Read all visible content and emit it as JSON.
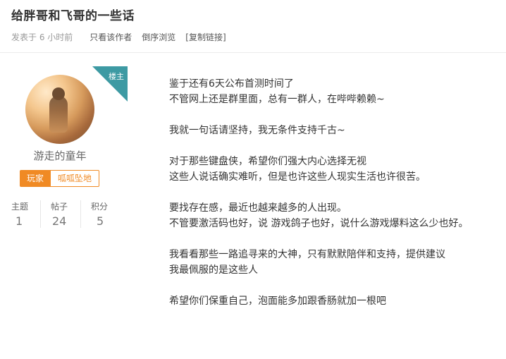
{
  "header": {
    "title": "给胖哥和飞哥的一些话"
  },
  "meta": {
    "posted": "发表于  6 小时前",
    "author_only": "只看该作者",
    "reverse_order": "倒序浏览",
    "copy_link": "[复制链接]"
  },
  "author": {
    "owner_badge": "楼主",
    "name": "游走的童年",
    "tags": [
      "玩家",
      "呱呱坠地"
    ],
    "stats": [
      {
        "label": "主题",
        "value": "1"
      },
      {
        "label": "帖子",
        "value": "24"
      },
      {
        "label": "积分",
        "value": "5"
      }
    ]
  },
  "post": {
    "paragraphs": [
      [
        "鉴于还有6天公布首测时间了",
        "不管网上还是群里面，总有一群人，在哔哔赖赖~"
      ],
      [
        "我就一句话请坚持，我无条件支持千古~"
      ],
      [
        "对于那些键盘侠，希望你们强大内心选择无视",
        "这些人说话确实难听，但是也许这些人现实生活也许很苦。"
      ],
      [
        "要找存在感，最近也越来越多的人出现。",
        "不管要激活码也好，说 游戏鸽子也好，说什么游戏爆料这么少也好。"
      ],
      [
        "我看看那些一路追寻来的大神，只有默默陪伴和支持，提供建议",
        "我最佩服的是这些人"
      ],
      [
        "希望你们保重自己，泡面能多加跟香肠就加一根吧"
      ]
    ]
  },
  "colors": {
    "accent_orange": "#f08a24",
    "owner_teal": "#3d9aa3"
  }
}
